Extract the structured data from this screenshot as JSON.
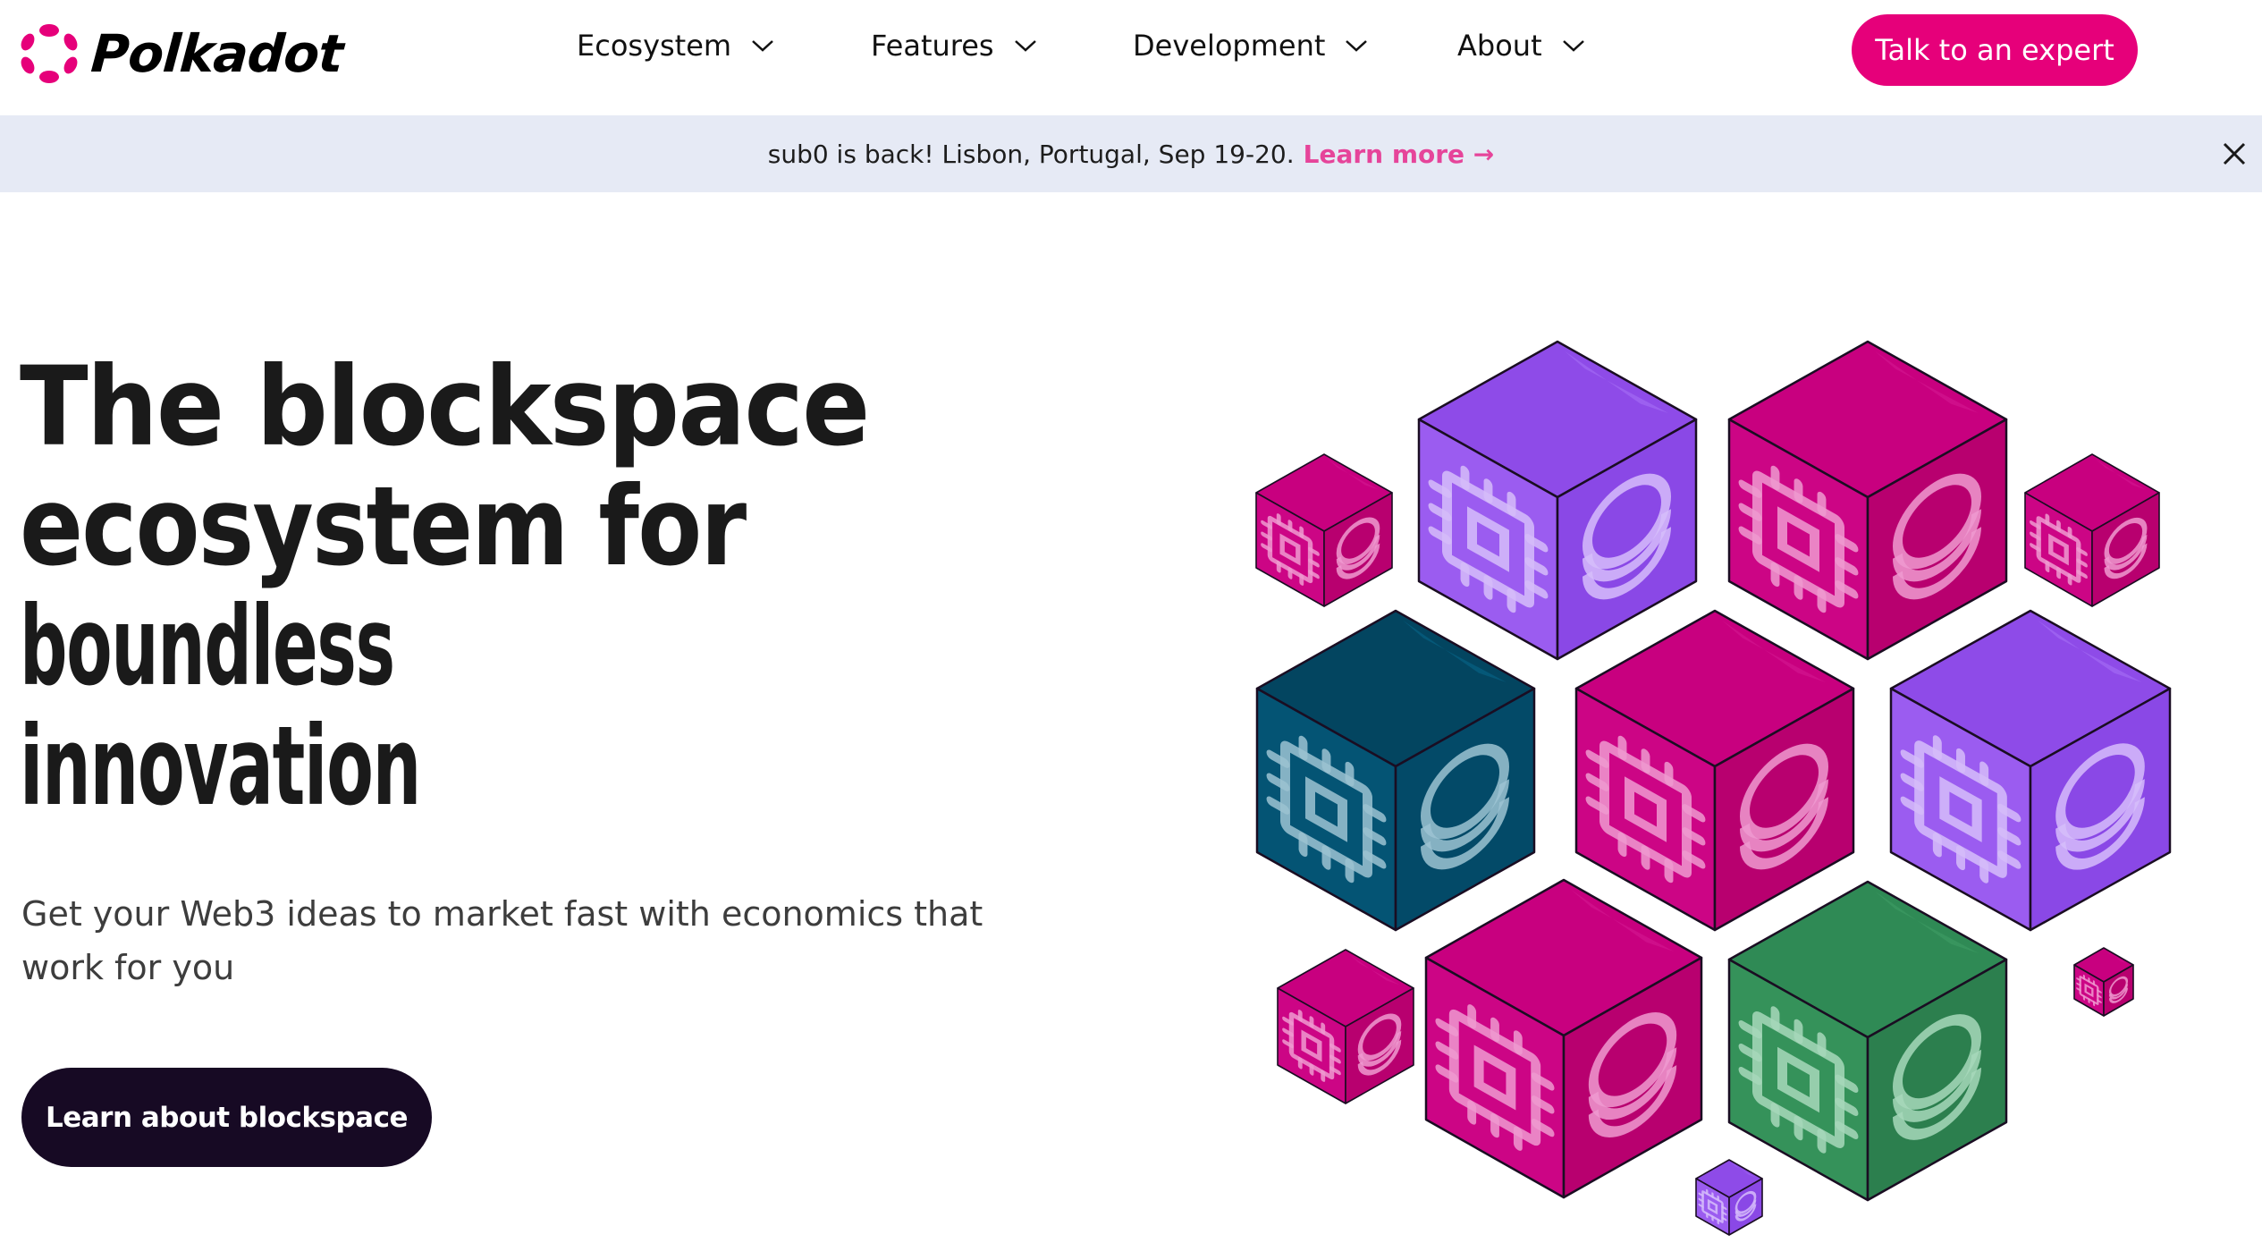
{
  "brand": {
    "name": "Polkadot",
    "accent": "#e6007a",
    "dark": "#170a24",
    "logo_icon": "polkadot-ring-icon"
  },
  "nav": {
    "items": [
      {
        "label": "Ecosystem",
        "icon": "chevron-down-icon"
      },
      {
        "label": "Features",
        "icon": "chevron-down-icon"
      },
      {
        "label": "Development",
        "icon": "chevron-down-icon"
      },
      {
        "label": "About",
        "icon": "chevron-down-icon"
      }
    ],
    "cta_label": "Talk to an expert"
  },
  "banner": {
    "text": "sub0 is back! Lisbon, Portugal, Sep 19-20.",
    "link_label": "Learn more",
    "link_icon": "arrow-right-icon",
    "close_icon": "close-icon",
    "background": "#e6eaf5",
    "link_color": "#e6449a"
  },
  "hero": {
    "headline_lines": [
      "The blockspace",
      "ecosystem for",
      "boundless",
      "innovation"
    ],
    "subtext": "Get your Web3 ideas to market fast with economics that work for you",
    "button_label": "Learn about blockspace"
  },
  "illustration": {
    "description": "Isometric cubes with chip and coin-stack icons",
    "face_icons": [
      "cpu-chip-icon",
      "coin-stack-icon"
    ],
    "palettes": {
      "purple": {
        "top": "#8e4be8",
        "left": "#9b5cf0",
        "right": "#8a48e6",
        "icon": "#d6bdfa",
        "shine": "#a873f5"
      },
      "pink": {
        "top": "#c8007f",
        "left": "#cc0585",
        "right": "#b8006f",
        "icon": "#ef9ad0",
        "shine": "#d61a93"
      },
      "teal": {
        "top": "#034560",
        "left": "#045474",
        "right": "#034a68",
        "icon": "#9cc3d2",
        "shine": "#07678c"
      },
      "green": {
        "top": "#2f8a55",
        "left": "#35925a",
        "right": "#2c7f4e",
        "icon": "#a7d8bb",
        "shine": "#3f9f66"
      }
    },
    "cubes": [
      {
        "name": "cube-purple-top",
        "color": "purple"
      },
      {
        "name": "cube-pink-top",
        "color": "pink"
      },
      {
        "name": "cube-teal",
        "color": "teal"
      },
      {
        "name": "cube-pink-center",
        "color": "pink"
      },
      {
        "name": "cube-purple-right",
        "color": "purple"
      },
      {
        "name": "cube-pink-bottom",
        "color": "pink"
      },
      {
        "name": "cube-green",
        "color": "green"
      },
      {
        "name": "cube-small-pink-left",
        "color": "pink"
      },
      {
        "name": "cube-small-pink-right",
        "color": "pink"
      },
      {
        "name": "cube-small-pink-bottom-left",
        "color": "pink"
      },
      {
        "name": "cube-tiny-pink",
        "color": "pink"
      },
      {
        "name": "cube-tiny-purple",
        "color": "purple"
      }
    ]
  }
}
